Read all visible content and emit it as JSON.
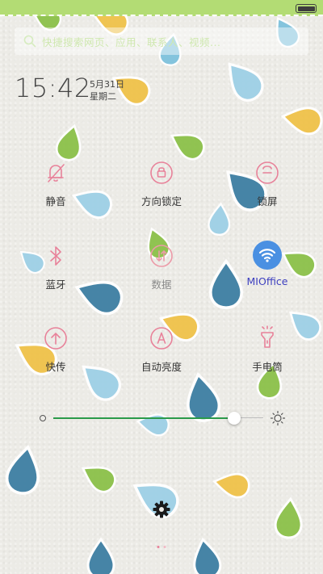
{
  "status_bar": {
    "battery_icon": "battery-icon",
    "accent": "#b3dc74"
  },
  "search": {
    "placeholder": "快捷搜索网页、应用、联系人、视频...",
    "icon": "search-icon"
  },
  "clock": {
    "time": "15:42",
    "date": "5月31日",
    "weekday": "星期二"
  },
  "toggles": [
    {
      "label": "静音",
      "icon": "bell-off-icon",
      "state": "off"
    },
    {
      "label": "方向锁定",
      "icon": "rotation-lock-icon",
      "state": "off"
    },
    {
      "label": "锁屏",
      "icon": "lock-icon",
      "state": "off"
    },
    {
      "label": "蓝牙",
      "icon": "bluetooth-icon",
      "state": "off"
    },
    {
      "label": "数据",
      "icon": "mobile-data-icon",
      "state": "disabled"
    },
    {
      "label": "MIOffice",
      "icon": "wifi-icon",
      "state": "on"
    },
    {
      "label": "快传",
      "icon": "share-arrow-icon",
      "state": "off"
    },
    {
      "label": "自动亮度",
      "icon": "auto-brightness-icon",
      "state": "off"
    },
    {
      "label": "手电筒",
      "icon": "flashlight-icon",
      "state": "off"
    }
  ],
  "brightness": {
    "level": 0.86,
    "min_icon": "brightness-low-icon",
    "max_icon": "brightness-high-icon"
  },
  "settings": {
    "icon": "gear-icon"
  },
  "colors": {
    "icon_pink": "#e8829a",
    "active_blue": "#4a90e2",
    "slider_green": "#2a9a4a"
  }
}
